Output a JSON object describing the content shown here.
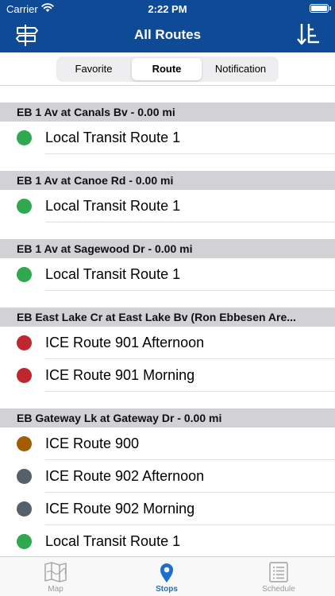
{
  "status_bar": {
    "carrier": "Carrier",
    "time": "2:22 PM"
  },
  "nav": {
    "title": "All Routes",
    "left_icon": "signpost-icon",
    "right_icon": "sort-icon"
  },
  "segments": [
    "Favorite",
    "Route",
    "Notification"
  ],
  "selected_segment": "Route",
  "colors": {
    "nav_bg": "#0e4a96",
    "green": "#2fa84f",
    "red": "#c0262d",
    "orange": "#a35c00",
    "gray": "#56606b",
    "tab_active": "#1c6fcf"
  },
  "sections": [
    {
      "header": "EB 1 Av at Canals Bv - 0.00 mi",
      "routes": [
        {
          "name": "Local Transit Route 1",
          "color": "#2fa84f"
        }
      ]
    },
    {
      "header": "EB 1 Av at Canoe Rd - 0.00 mi",
      "routes": [
        {
          "name": "Local Transit Route 1",
          "color": "#2fa84f"
        }
      ]
    },
    {
      "header": "EB 1 Av at Sagewood Dr - 0.00 mi",
      "routes": [
        {
          "name": "Local Transit Route 1",
          "color": "#2fa84f"
        }
      ]
    },
    {
      "header": "EB East Lake Cr at East Lake Bv (Ron Ebbesen Are...",
      "routes": [
        {
          "name": "ICE Route 901 Afternoon",
          "color": "#c0262d"
        },
        {
          "name": "ICE Route 901 Morning",
          "color": "#c0262d"
        }
      ]
    },
    {
      "header": "EB Gateway Lk at Gateway Dr - 0.00 mi",
      "routes": [
        {
          "name": "ICE Route 900",
          "color": "#a35c00"
        },
        {
          "name": "ICE Route 902 Afternoon",
          "color": "#56606b"
        },
        {
          "name": "ICE Route 902 Morning",
          "color": "#56606b"
        },
        {
          "name": "Local Transit Route 1",
          "color": "#2fa84f"
        }
      ]
    }
  ],
  "tabs": [
    {
      "label": "Map",
      "icon": "map-icon"
    },
    {
      "label": "Stops",
      "icon": "location-pin-icon"
    },
    {
      "label": "Schedule",
      "icon": "schedule-list-icon"
    }
  ],
  "selected_tab": "Stops"
}
